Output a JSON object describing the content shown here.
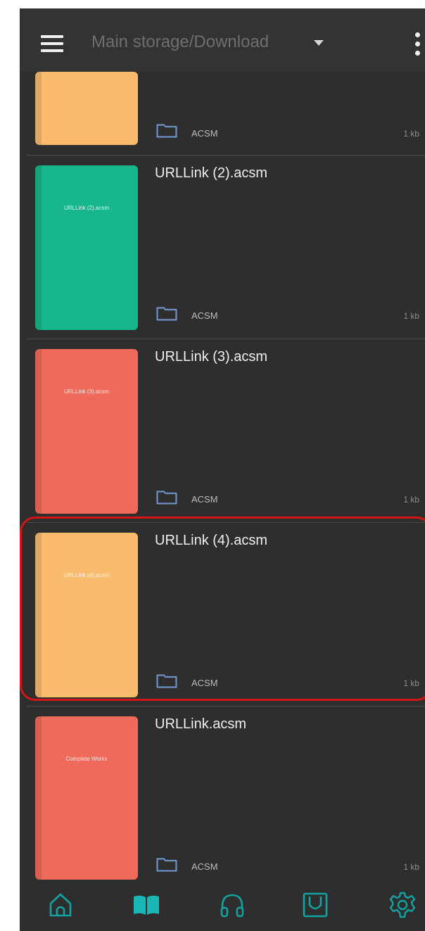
{
  "app_bar": {
    "path_title": "Main storage/Download"
  },
  "files": [
    {
      "title": "",
      "cover_text": "",
      "cover_color": "#F9BB6E",
      "format": "ACSM",
      "size": "1 kb"
    },
    {
      "title": "URLLink (2).acsm",
      "cover_text": "URLLink (2).acsm",
      "cover_color": "#17B68C",
      "format": "ACSM",
      "size": "1 kb"
    },
    {
      "title": "URLLink (3).acsm",
      "cover_text": "URLLink (3).acsm",
      "cover_color": "#EF6A5A",
      "format": "ACSM",
      "size": "1 kb"
    },
    {
      "title": "URLLink (4).acsm",
      "cover_text": "URLLink (4).acsm",
      "cover_color": "#F9BB6E",
      "format": "ACSM",
      "size": "1 kb"
    },
    {
      "title": "URLLink.acsm",
      "cover_text": "Complete Works",
      "cover_color": "#EF6A5A",
      "format": "ACSM",
      "size": "1 kb"
    }
  ],
  "bottom_nav": [
    {
      "icon": "home-icon",
      "active": false
    },
    {
      "icon": "book-icon",
      "active": true
    },
    {
      "icon": "headphones-icon",
      "active": false
    },
    {
      "icon": "shop-bag-icon",
      "active": false
    },
    {
      "icon": "gear-icon",
      "active": false
    }
  ],
  "colors": {
    "background": "#2E2E2E",
    "accent": "#1AB5B5",
    "inactive_icon": "#12A2A2",
    "folder_icon": "#6E90C7",
    "highlight": "#D31515"
  }
}
